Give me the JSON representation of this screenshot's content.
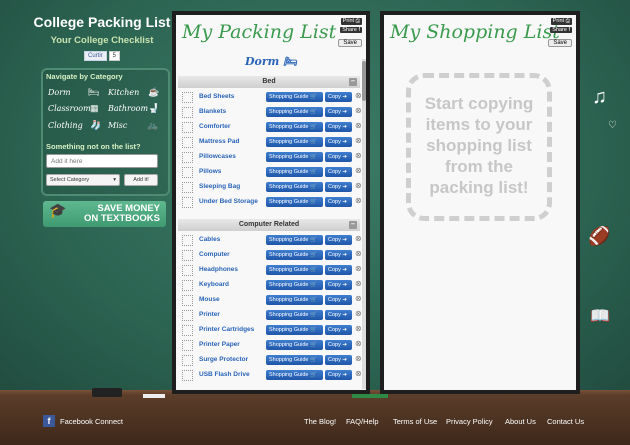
{
  "site": {
    "title": "College Packing List",
    "subtitle": "Your College Checklist",
    "like_label": "Curtir",
    "like_count": "5"
  },
  "nav": {
    "heading": "Navigate by Category",
    "categories": [
      "Dorm",
      "Kitchen",
      "Classroom",
      "Bathroom",
      "Clothing",
      "Misc"
    ],
    "not_on_list": "Something not on the list?",
    "add_placeholder": "Add it here",
    "select_label": "Select Category",
    "add_button": "Add it!"
  },
  "promo": {
    "line1": "SAVE MONEY",
    "line2": "ON TEXTBOOKS"
  },
  "packing": {
    "title": "My Packing List",
    "print": "Print",
    "share": "Share",
    "save": "Save",
    "list_name": "Dorm",
    "sections": [
      {
        "name": "Bed",
        "items": [
          "Bed Sheets",
          "Blankets",
          "Comforter",
          "Mattress Pad",
          "Pillowcases",
          "Pillows",
          "Sleeping Bag",
          "Under Bed Storage"
        ]
      },
      {
        "name": "Computer Related",
        "items": [
          "Cables",
          "Computer",
          "Headphones",
          "Keyboard",
          "Mouse",
          "Printer",
          "Printer Cartridges",
          "Printer Paper",
          "Surge Protector",
          "USB Flash Drive"
        ]
      }
    ],
    "guide_label": "Shopping Guide",
    "copy_label": "Copy"
  },
  "shopping": {
    "title": "My Shopping List",
    "print": "Print",
    "share": "Share",
    "save": "Save",
    "empty_lines": [
      "Start copying",
      "items to your",
      "shopping list",
      "from the",
      "packing list!"
    ]
  },
  "footer": {
    "facebook": "Facebook Connect",
    "links": [
      "The Blog!",
      "FAQ/Help",
      "Terms of Use",
      "Privacy Policy",
      "About Us",
      "Contact Us"
    ]
  },
  "colors": {
    "chalkboard": "#2f6b57",
    "panel_title": "#3a9a4e",
    "button_blue": "#1f56a8",
    "link_blue": "#2a64b8"
  }
}
